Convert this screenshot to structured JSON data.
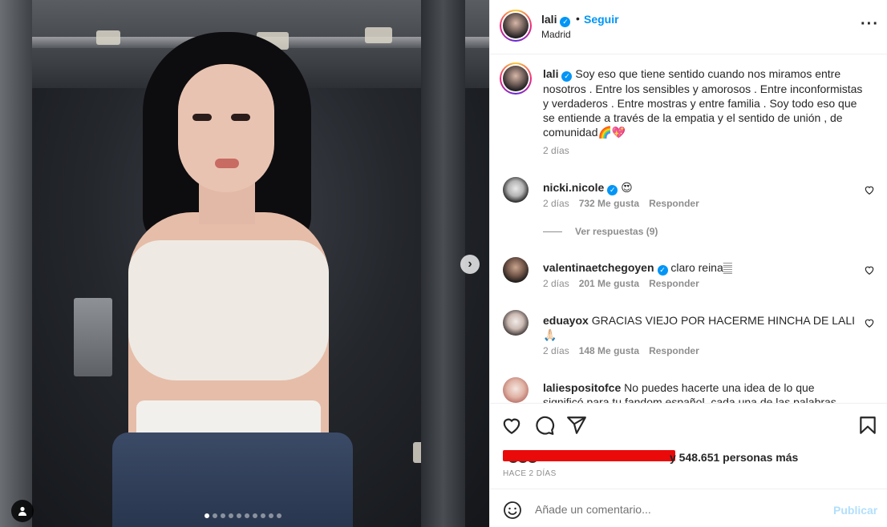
{
  "post": {
    "username": "lali",
    "follow_label": "Seguir",
    "separator": "•",
    "location": "Madrid",
    "more_icon": "more-horizontal-icon",
    "carousel": {
      "total": 10,
      "active": 0,
      "next_icon": "chevron-right-icon"
    },
    "caption": {
      "username": "lali",
      "text": "Soy eso que tiene sentido cuando nos miramos entre nosotros . Entre los sensibles y amorosos . Entre inconformistas y verdaderos . Entre mostras y entre familia . Soy todo eso que se entiende a través de la empatia y el sentido de unión , de comunidad🌈💖",
      "time": "2 días"
    }
  },
  "comments": [
    {
      "username": "nicki.nicole",
      "verified": true,
      "text": "😍",
      "time": "2 días",
      "likes": "732 Me gusta",
      "reply": "Responder"
    },
    {
      "username": "valentinaetchegoyen",
      "verified": true,
      "text": "claro reina𝄛",
      "time": "2 días",
      "likes": "201 Me gusta",
      "reply": "Responder"
    },
    {
      "username": "eduayox",
      "verified": false,
      "text": "GRACIAS VIEJO POR HACERME HINCHA DE LALI 🙏🏻",
      "time": "2 días",
      "likes": "148 Me gusta",
      "reply": "Responder"
    },
    {
      "username": "laliespositofce",
      "verified": false,
      "text": "No puedes hacerte una idea de lo que significó para tu fandom español, cada una de las palabras",
      "time": "",
      "likes": "",
      "reply": ""
    }
  ],
  "view_replies": "Ver respuestas (9)",
  "likes_summary": "y 548.651 personas más",
  "posted_time": "HACE 2 DÍAS",
  "composer": {
    "placeholder": "Añade un comentario...",
    "publish_label": "Publicar"
  },
  "colors": {
    "accent": "#0095f6",
    "redaction": "#ea0a0a",
    "muted": "#8e8e8e"
  }
}
